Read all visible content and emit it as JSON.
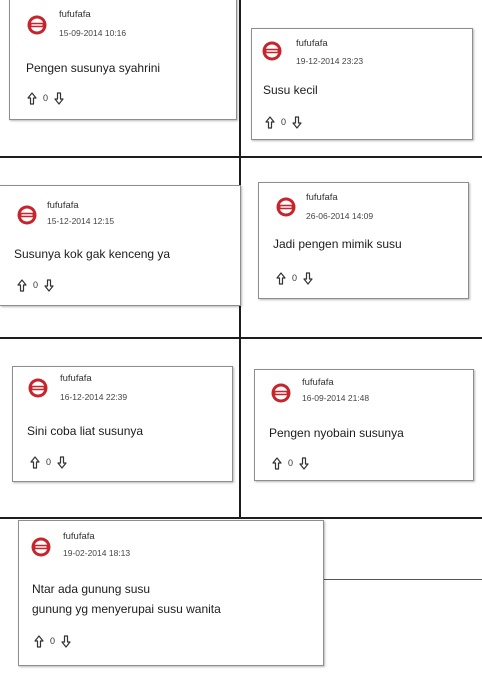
{
  "comments": [
    {
      "username": "fufufafa",
      "date": "15-09-2014 10:16",
      "text": "Pengen susunya syahrini",
      "votes": "0"
    },
    {
      "username": "fufufafa",
      "date": "19-12-2014 23:23",
      "text": "Susu kecil",
      "votes": "0"
    },
    {
      "username": "fufufafa",
      "date": "15-12-2014 12:15",
      "text": "Susunya kok gak kenceng ya",
      "votes": "0"
    },
    {
      "username": "fufufafa",
      "date": "26-06-2014 14:09",
      "text": "Jadi pengen mimik susu",
      "votes": "0"
    },
    {
      "username": "fufufafa",
      "date": "16-12-2014 22:39",
      "text": "Sini coba liat susunya",
      "votes": "0"
    },
    {
      "username": "fufufafa",
      "date": "16-09-2014 21:48",
      "text": "Pengen nyobain susunya",
      "votes": "0"
    },
    {
      "username": "fufufafa",
      "date": "19-02-2014 18:13",
      "text_lines": [
        "Ntar ada gunung susu",
        "gunung yg menyerupai susu wanita"
      ],
      "votes": "0"
    }
  ],
  "colors": {
    "avatar_red": "#c8242b",
    "divider": "#1d1d1d",
    "card_border": "#8e8e8e"
  },
  "icons": {
    "upvote": "arrow-up-outline-icon",
    "downvote": "arrow-down-outline-icon",
    "avatar": "kaskus-logo-avatar-icon"
  }
}
